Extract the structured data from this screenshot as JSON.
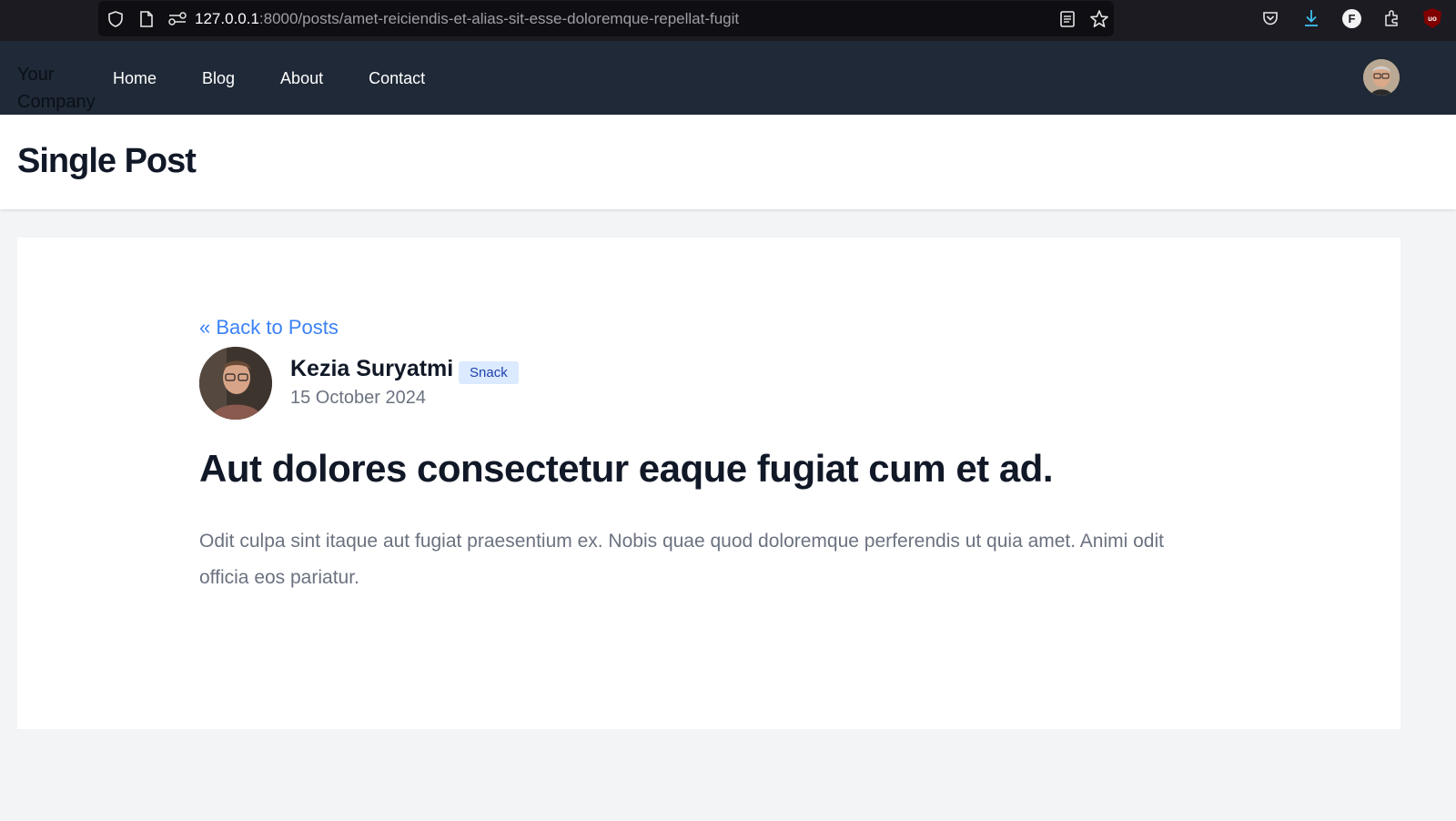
{
  "browser": {
    "url_host": "127.0.0.1",
    "url_path": ":8000/posts/amet-reiciendis-et-alias-sit-esse-doloremque-repellat-fugit",
    "icons": [
      "shield-icon",
      "page-icon",
      "permissions-icon",
      "reader-view-icon",
      "bookmark-star-icon",
      "pocket-icon",
      "download-icon",
      "profile-f-icon",
      "extensions-icon",
      "ublock-icon"
    ],
    "profile_letter": "F",
    "ublock_label": "uo"
  },
  "nav": {
    "brand": "Your Company",
    "links": [
      {
        "label": "Home"
      },
      {
        "label": "Blog"
      },
      {
        "label": "About"
      },
      {
        "label": "Contact"
      }
    ]
  },
  "header": {
    "title": "Single Post"
  },
  "post": {
    "back_label": "« Back to Posts",
    "author": "Kezia Suryatmi",
    "category": "Snack",
    "date": "15 October 2024",
    "title": "Aut dolores consectetur eaque fugiat cum et ad.",
    "body": "Odit culpa sint itaque aut fugiat praesentium ex. Nobis quae quod doloremque perferendis ut quia amet. Animi odit officia eos pariatur."
  },
  "colors": {
    "nav_bg": "#1f2937",
    "link_blue": "#3b82f6",
    "badge_bg": "#dbeafe",
    "badge_text": "#1e40af",
    "page_bg": "#f3f4f6"
  }
}
